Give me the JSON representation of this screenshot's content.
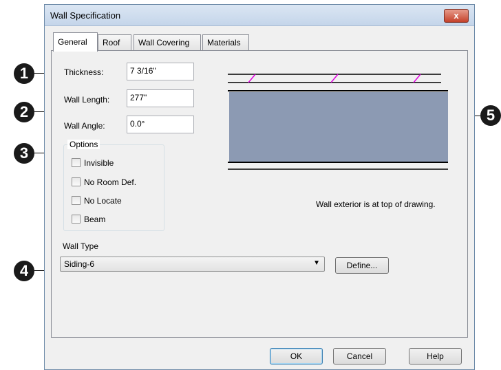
{
  "dialog": {
    "title": "Wall Specification",
    "close_glyph": "x"
  },
  "tabs": [
    {
      "label": "General",
      "active": true
    },
    {
      "label": "Roof",
      "active": false
    },
    {
      "label": "Wall Covering",
      "active": false
    },
    {
      "label": "Materials",
      "active": false
    }
  ],
  "general": {
    "thickness_label": "Thickness:",
    "thickness_value": "7 3/16\"",
    "length_label": "Wall Length:",
    "length_value": "277\"",
    "angle_label": "Wall Angle:",
    "angle_value": "0.0°",
    "options_title": "Options",
    "options": [
      {
        "label": "Invisible",
        "checked": false
      },
      {
        "label": "No Room Def.",
        "checked": false
      },
      {
        "label": "No Locate",
        "checked": false
      },
      {
        "label": "Beam",
        "checked": false
      }
    ],
    "wall_type_label": "Wall Type",
    "wall_type_value": "Siding-6",
    "define_label": "Define...",
    "preview_caption": "Wall exterior is at top of drawing."
  },
  "buttons": {
    "ok": "OK",
    "cancel": "Cancel",
    "help": "Help"
  },
  "callouts": [
    "1",
    "2",
    "3",
    "4",
    "5"
  ],
  "colors": {
    "wall_fill": "#8c9ab3",
    "hatch": "#e000e0"
  }
}
